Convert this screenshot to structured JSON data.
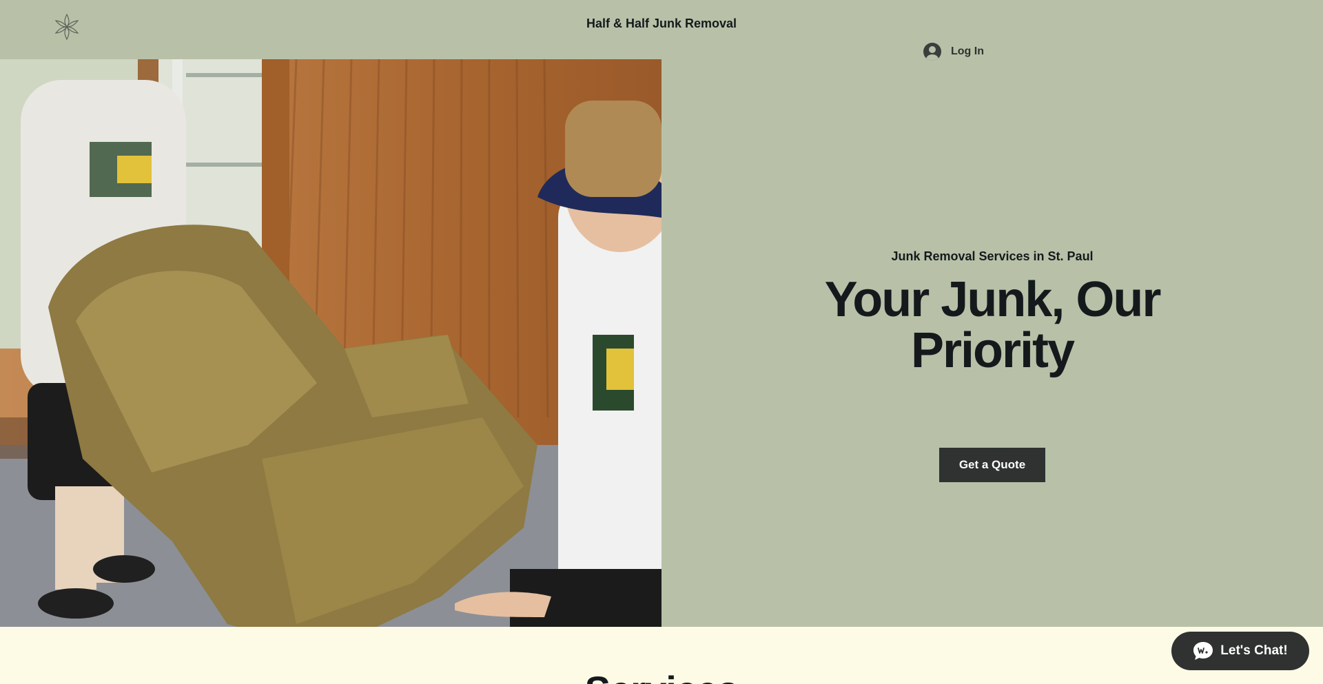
{
  "header": {
    "site_title": "Half & Half Junk Removal",
    "login_label": "Log In",
    "logo_icon": "asterisk-flower-icon"
  },
  "hero": {
    "subtitle": "Junk Removal Services in St. Paul",
    "title": "Your Junk, Our Priority",
    "cta_label": "Get a Quote",
    "image_alt": "Two workers carrying an old armchair"
  },
  "next_section": {
    "heading": "Services"
  },
  "chat": {
    "label": "Let's Chat!",
    "icon": "chat-bubble-icon"
  },
  "colors": {
    "background": "#b8c1a8",
    "text": "#141a1c",
    "button": "#2f3231",
    "section_bg": "#fdfbe6"
  }
}
